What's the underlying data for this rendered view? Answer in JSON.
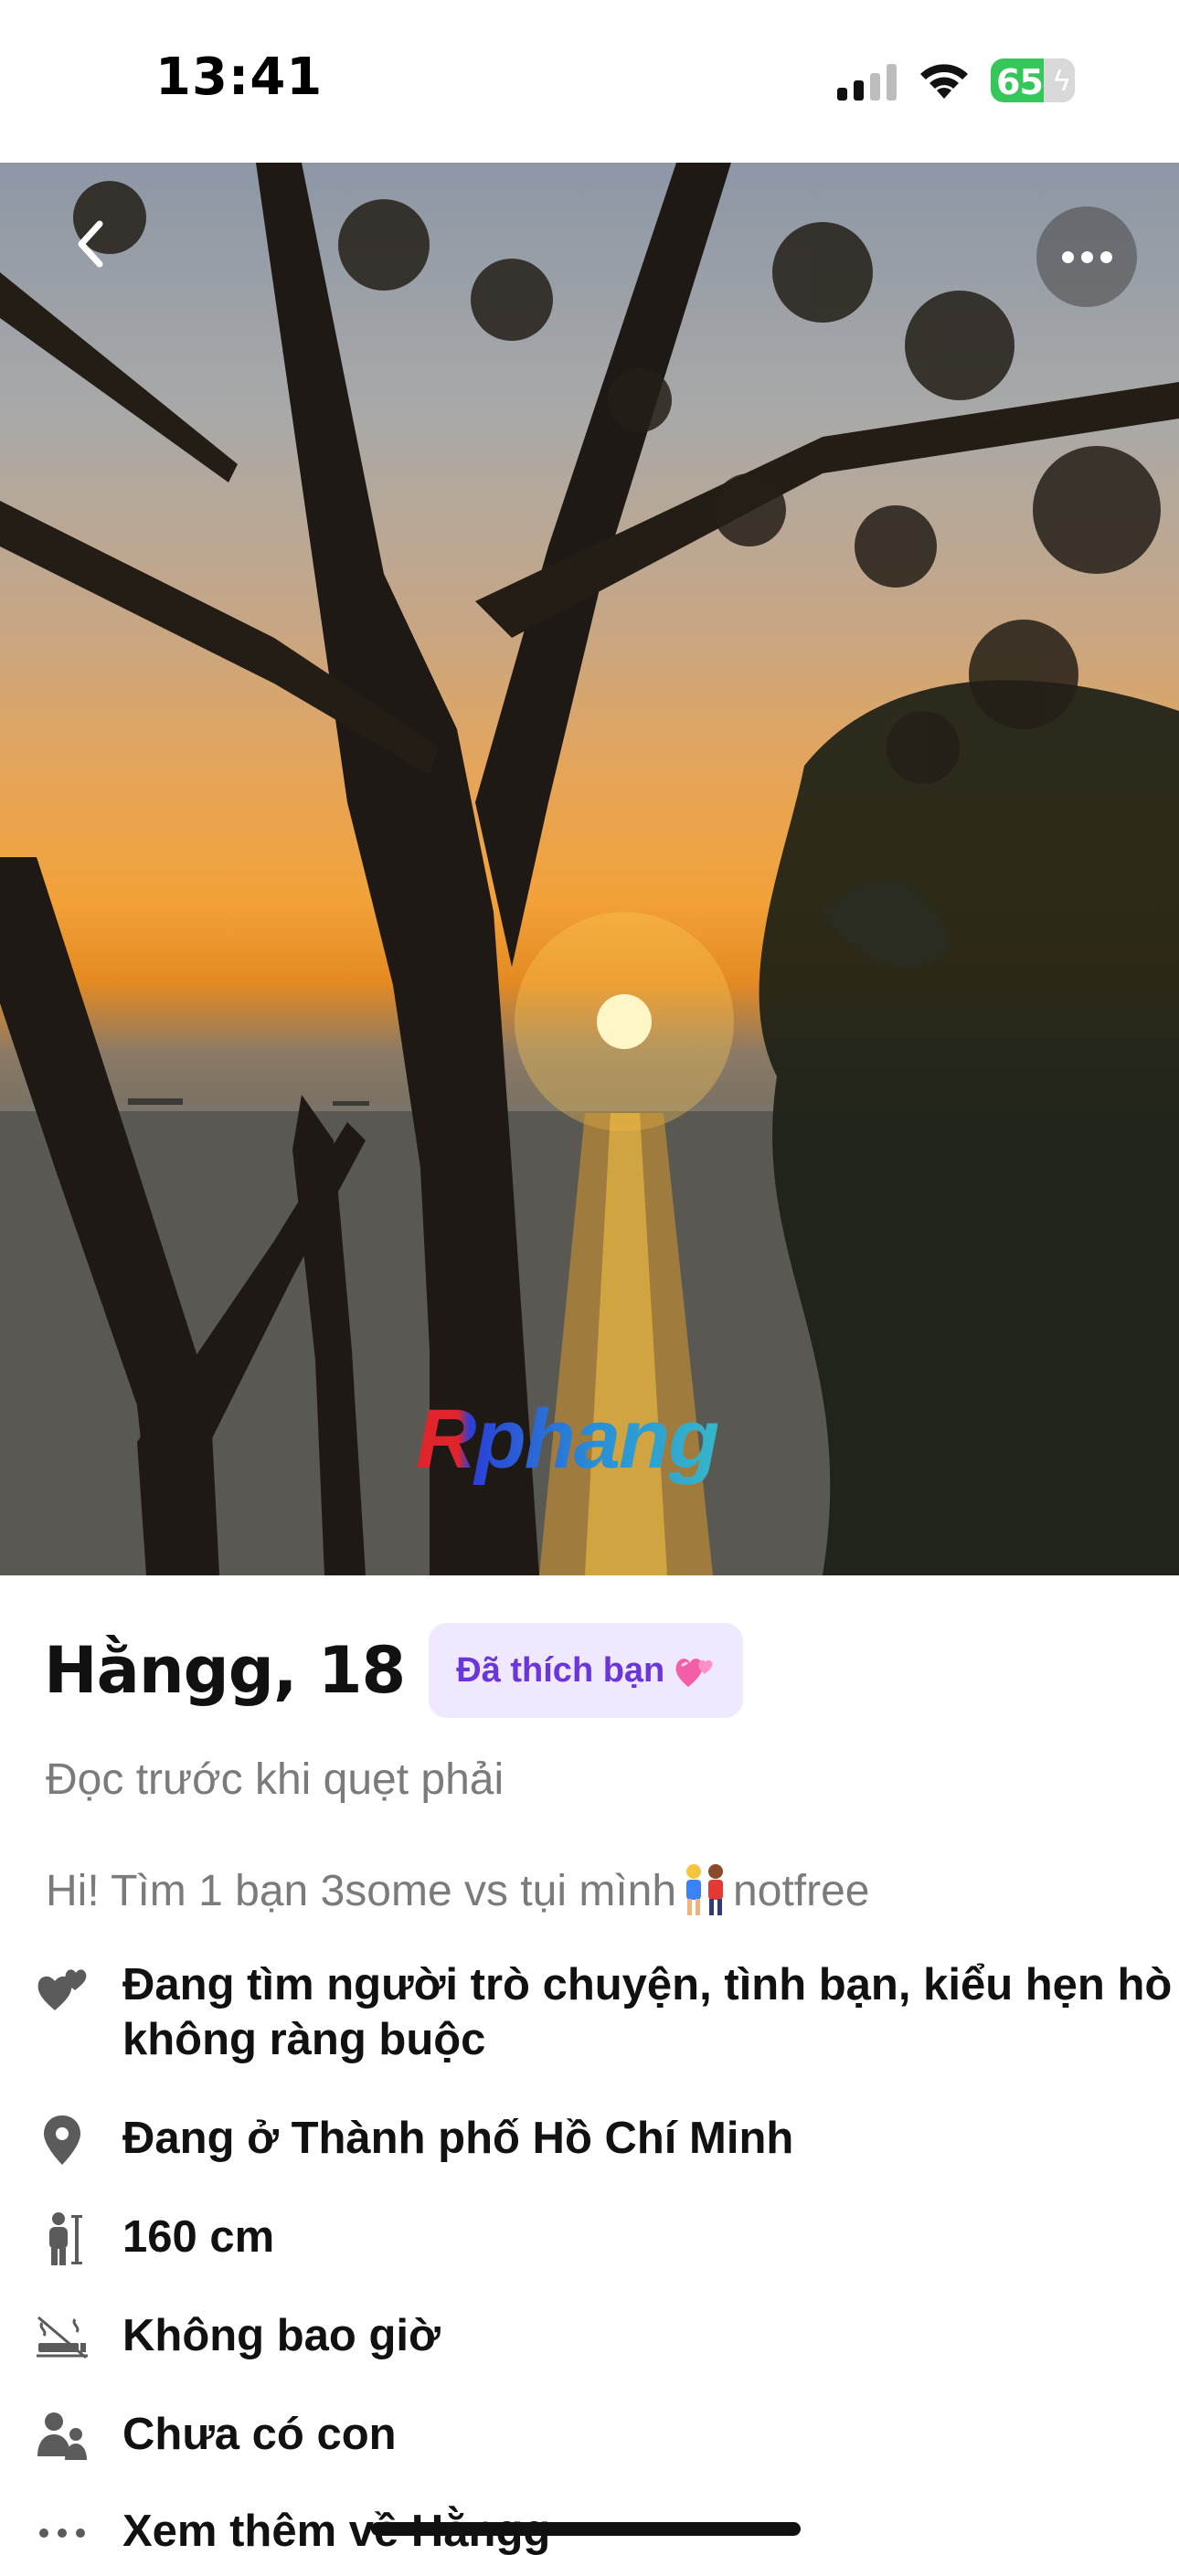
{
  "status_bar": {
    "time": "13:41",
    "battery_percent": "65"
  },
  "photo": {
    "watermark": "Rphang"
  },
  "profile": {
    "name_age": "Hằngg, 18",
    "liked_badge": "Đã thích bạn",
    "subtitle": "Đọc trước khi quẹt phải",
    "bio_before": "Hi! Tìm 1 bạn 3some vs tụi mình",
    "bio_after": "notfree",
    "details": [
      {
        "icon": "hearts-icon",
        "text": "Đang tìm người trò chuyện, tình bạn, kiểu hẹn hò không ràng buộc"
      },
      {
        "icon": "location-pin-icon",
        "text": "Đang ở Thành phố Hồ Chí Minh"
      },
      {
        "icon": "height-icon",
        "text": "160 cm"
      },
      {
        "icon": "smoking-icon",
        "text": "Không bao giờ"
      },
      {
        "icon": "children-icon",
        "text": "Chưa có con"
      }
    ],
    "see_more": "Xem thêm về Hằngg"
  },
  "colors": {
    "badge_bg": "#f0e8fe",
    "badge_text": "#6a35d9",
    "battery": "#34c759",
    "muted_text": "#7b7b7b"
  }
}
